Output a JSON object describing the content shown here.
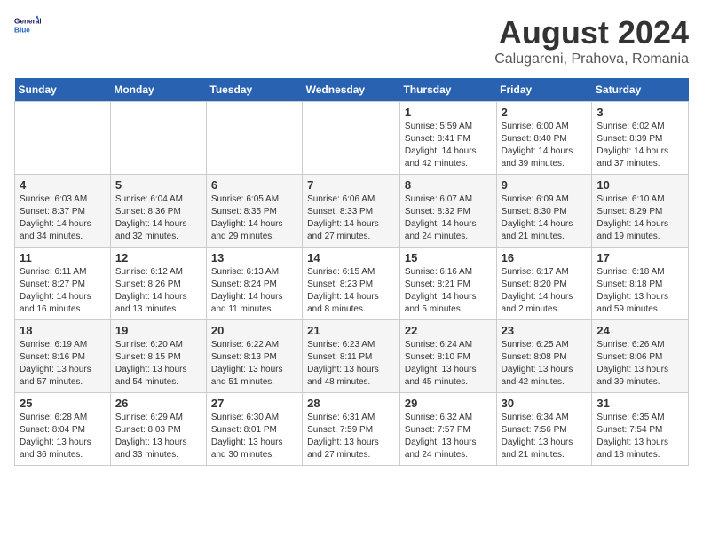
{
  "header": {
    "logo_line1": "General",
    "logo_line2": "Blue",
    "title": "August 2024",
    "subtitle": "Calugareni, Prahova, Romania"
  },
  "weekdays": [
    "Sunday",
    "Monday",
    "Tuesday",
    "Wednesday",
    "Thursday",
    "Friday",
    "Saturday"
  ],
  "weeks": [
    [
      {
        "day": "",
        "info": ""
      },
      {
        "day": "",
        "info": ""
      },
      {
        "day": "",
        "info": ""
      },
      {
        "day": "",
        "info": ""
      },
      {
        "day": "1",
        "info": "Sunrise: 5:59 AM\nSunset: 8:41 PM\nDaylight: 14 hours\nand 42 minutes."
      },
      {
        "day": "2",
        "info": "Sunrise: 6:00 AM\nSunset: 8:40 PM\nDaylight: 14 hours\nand 39 minutes."
      },
      {
        "day": "3",
        "info": "Sunrise: 6:02 AM\nSunset: 8:39 PM\nDaylight: 14 hours\nand 37 minutes."
      }
    ],
    [
      {
        "day": "4",
        "info": "Sunrise: 6:03 AM\nSunset: 8:37 PM\nDaylight: 14 hours\nand 34 minutes."
      },
      {
        "day": "5",
        "info": "Sunrise: 6:04 AM\nSunset: 8:36 PM\nDaylight: 14 hours\nand 32 minutes."
      },
      {
        "day": "6",
        "info": "Sunrise: 6:05 AM\nSunset: 8:35 PM\nDaylight: 14 hours\nand 29 minutes."
      },
      {
        "day": "7",
        "info": "Sunrise: 6:06 AM\nSunset: 8:33 PM\nDaylight: 14 hours\nand 27 minutes."
      },
      {
        "day": "8",
        "info": "Sunrise: 6:07 AM\nSunset: 8:32 PM\nDaylight: 14 hours\nand 24 minutes."
      },
      {
        "day": "9",
        "info": "Sunrise: 6:09 AM\nSunset: 8:30 PM\nDaylight: 14 hours\nand 21 minutes."
      },
      {
        "day": "10",
        "info": "Sunrise: 6:10 AM\nSunset: 8:29 PM\nDaylight: 14 hours\nand 19 minutes."
      }
    ],
    [
      {
        "day": "11",
        "info": "Sunrise: 6:11 AM\nSunset: 8:27 PM\nDaylight: 14 hours\nand 16 minutes."
      },
      {
        "day": "12",
        "info": "Sunrise: 6:12 AM\nSunset: 8:26 PM\nDaylight: 14 hours\nand 13 minutes."
      },
      {
        "day": "13",
        "info": "Sunrise: 6:13 AM\nSunset: 8:24 PM\nDaylight: 14 hours\nand 11 minutes."
      },
      {
        "day": "14",
        "info": "Sunrise: 6:15 AM\nSunset: 8:23 PM\nDaylight: 14 hours\nand 8 minutes."
      },
      {
        "day": "15",
        "info": "Sunrise: 6:16 AM\nSunset: 8:21 PM\nDaylight: 14 hours\nand 5 minutes."
      },
      {
        "day": "16",
        "info": "Sunrise: 6:17 AM\nSunset: 8:20 PM\nDaylight: 14 hours\nand 2 minutes."
      },
      {
        "day": "17",
        "info": "Sunrise: 6:18 AM\nSunset: 8:18 PM\nDaylight: 13 hours\nand 59 minutes."
      }
    ],
    [
      {
        "day": "18",
        "info": "Sunrise: 6:19 AM\nSunset: 8:16 PM\nDaylight: 13 hours\nand 57 minutes."
      },
      {
        "day": "19",
        "info": "Sunrise: 6:20 AM\nSunset: 8:15 PM\nDaylight: 13 hours\nand 54 minutes."
      },
      {
        "day": "20",
        "info": "Sunrise: 6:22 AM\nSunset: 8:13 PM\nDaylight: 13 hours\nand 51 minutes."
      },
      {
        "day": "21",
        "info": "Sunrise: 6:23 AM\nSunset: 8:11 PM\nDaylight: 13 hours\nand 48 minutes."
      },
      {
        "day": "22",
        "info": "Sunrise: 6:24 AM\nSunset: 8:10 PM\nDaylight: 13 hours\nand 45 minutes."
      },
      {
        "day": "23",
        "info": "Sunrise: 6:25 AM\nSunset: 8:08 PM\nDaylight: 13 hours\nand 42 minutes."
      },
      {
        "day": "24",
        "info": "Sunrise: 6:26 AM\nSunset: 8:06 PM\nDaylight: 13 hours\nand 39 minutes."
      }
    ],
    [
      {
        "day": "25",
        "info": "Sunrise: 6:28 AM\nSunset: 8:04 PM\nDaylight: 13 hours\nand 36 minutes."
      },
      {
        "day": "26",
        "info": "Sunrise: 6:29 AM\nSunset: 8:03 PM\nDaylight: 13 hours\nand 33 minutes."
      },
      {
        "day": "27",
        "info": "Sunrise: 6:30 AM\nSunset: 8:01 PM\nDaylight: 13 hours\nand 30 minutes."
      },
      {
        "day": "28",
        "info": "Sunrise: 6:31 AM\nSunset: 7:59 PM\nDaylight: 13 hours\nand 27 minutes."
      },
      {
        "day": "29",
        "info": "Sunrise: 6:32 AM\nSunset: 7:57 PM\nDaylight: 13 hours\nand 24 minutes."
      },
      {
        "day": "30",
        "info": "Sunrise: 6:34 AM\nSunset: 7:56 PM\nDaylight: 13 hours\nand 21 minutes."
      },
      {
        "day": "31",
        "info": "Sunrise: 6:35 AM\nSunset: 7:54 PM\nDaylight: 13 hours\nand 18 minutes."
      }
    ]
  ]
}
